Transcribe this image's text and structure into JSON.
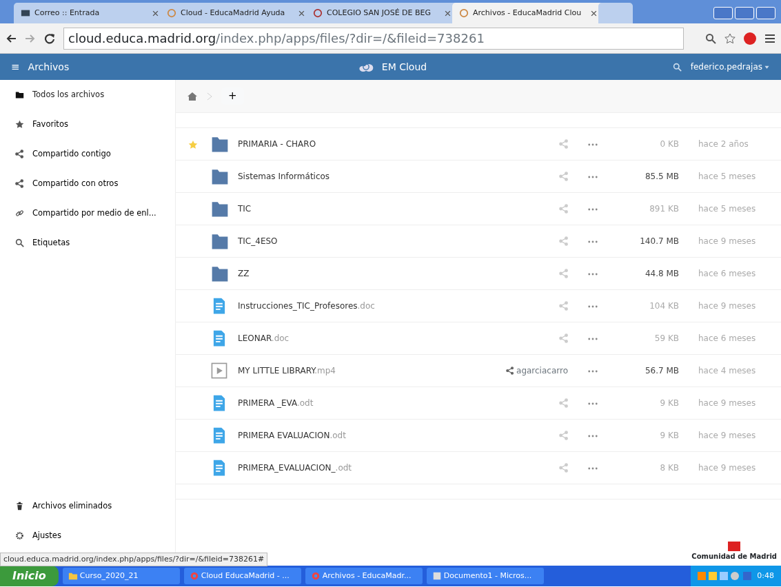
{
  "browser": {
    "tabs": [
      {
        "title": "Correo :: Entrada",
        "selected": false
      },
      {
        "title": "Cloud - EducaMadrid Ayuda",
        "selected": false
      },
      {
        "title": "COLEGIO SAN JOSÉ DE BEG",
        "selected": false
      },
      {
        "title": "Archivos - EducaMadrid Clou",
        "selected": true
      }
    ],
    "url_host": "cloud.educa.madrid.org",
    "url_path": "/index.php/apps/files/?dir=/&fileid=738261"
  },
  "header": {
    "menu_glyph": "≡",
    "app_title": "Archivos",
    "brand": "EM Cloud",
    "user": "federico.pedrajas"
  },
  "sidebar": {
    "items": [
      {
        "label": "Todos los archivos",
        "selected": true
      },
      {
        "label": "Favoritos",
        "selected": false
      },
      {
        "label": "Compartido contigo",
        "selected": false
      },
      {
        "label": "Compartido con otros",
        "selected": false
      },
      {
        "label": "Compartido por medio de enl...",
        "selected": false
      },
      {
        "label": "Etiquetas",
        "selected": false
      }
    ],
    "bottom_items": [
      {
        "label": "Archivos eliminados"
      },
      {
        "label": "Ajustes"
      }
    ]
  },
  "breadcrumb": {
    "add_glyph": "+"
  },
  "files": [
    {
      "name": "PRIMARIA - CHARO",
      "kind": "folder",
      "favorite": true,
      "size": "0 KB",
      "size_large": false,
      "modified": "hace 2 años"
    },
    {
      "name": "Sistemas Informáticos",
      "kind": "folder",
      "favorite": false,
      "size": "85.5 MB",
      "size_large": true,
      "modified": "hace 5 meses"
    },
    {
      "name": "TIC",
      "kind": "folder",
      "favorite": false,
      "size": "891 KB",
      "size_large": false,
      "modified": "hace 5 meses"
    },
    {
      "name": "TIC_4ESO",
      "kind": "folder",
      "favorite": false,
      "size": "140.7 MB",
      "size_large": true,
      "modified": "hace 9 meses"
    },
    {
      "name": "ZZ",
      "kind": "folder",
      "favorite": false,
      "size": "44.8 MB",
      "size_large": true,
      "modified": "hace 6 meses"
    },
    {
      "name": "Instrucciones_TIC_Profesores",
      "ext": ".doc",
      "kind": "document",
      "favorite": false,
      "size": "104 KB",
      "size_large": false,
      "modified": "hace 9 meses"
    },
    {
      "name": "LEONAR",
      "ext": ".doc",
      "kind": "document",
      "favorite": false,
      "size": "59 KB",
      "size_large": false,
      "modified": "hace 6 meses"
    },
    {
      "name": "MY LITTLE LIBRARY",
      "ext": ".mp4",
      "kind": "video",
      "favorite": false,
      "shared_with": "agarciacarro",
      "size": "56.7 MB",
      "size_large": true,
      "modified": "hace 4 meses"
    },
    {
      "name": "PRIMERA _EVA",
      "ext": ".odt",
      "kind": "document",
      "favorite": false,
      "size": "9 KB",
      "size_large": false,
      "modified": "hace 9 meses"
    },
    {
      "name": "PRIMERA EVALUACION",
      "ext": ".odt",
      "kind": "document",
      "favorite": false,
      "size": "9 KB",
      "size_large": false,
      "modified": "hace 9 meses"
    },
    {
      "name": "PRIMERA_EVALUACION_",
      "ext": ".odt",
      "kind": "document",
      "favorite": false,
      "size": "8 KB",
      "size_large": false,
      "modified": "hace 9 meses"
    }
  ],
  "footer_logo": "Comunidad de Madrid",
  "status_url": "cloud.educa.madrid.org/index.php/apps/files/?dir=/&fileid=738261#",
  "taskbar": {
    "start": "Inicio",
    "items": [
      {
        "label": "Curso_2020_21",
        "kind": "folder"
      },
      {
        "label": "Cloud EducaMadrid - ...",
        "kind": "browser"
      },
      {
        "label": "Archivos - EducaMadr...",
        "kind": "browser"
      },
      {
        "label": "Documento1 - Micros...",
        "kind": "document"
      }
    ],
    "clock": "0:48"
  }
}
